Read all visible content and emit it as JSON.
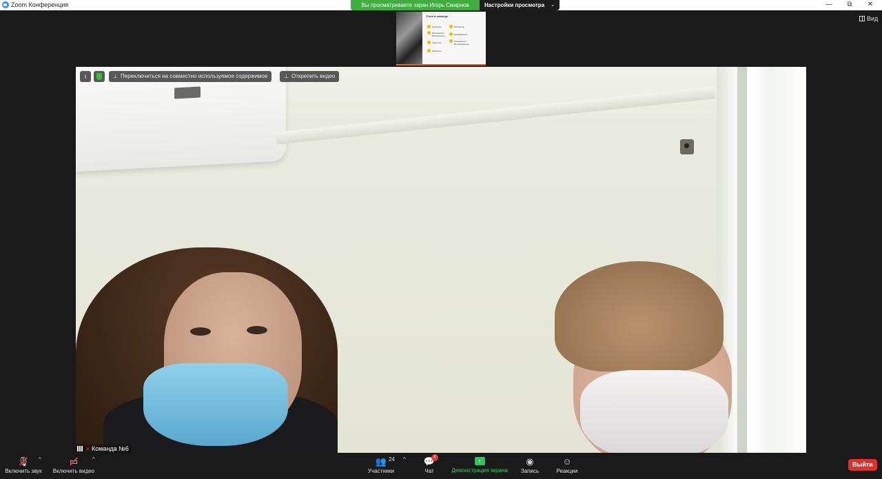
{
  "window": {
    "title": "Zoom Конференция",
    "minimize": "—",
    "restore": "⧉",
    "close": "✕"
  },
  "share_banner": {
    "text": "Вы просматриваете экран Игорь Смирнов",
    "view_options": "Настройки просмотра",
    "chevron": "⌄"
  },
  "thumbnail": {
    "heading": "Роли в команде",
    "items": [
      "Кураторы",
      "Реализатор / Исполнитель",
      "Аналитик",
      "Эксперты",
      "Мотиватор",
      "Наблюдатель",
      "Специалист / Исследователь"
    ]
  },
  "view_button": {
    "label": "Вид"
  },
  "video_controls": {
    "info": "i",
    "switch_label": "Переключиться на совместно используемое содержимое",
    "unpin_label": "Открепить видео"
  },
  "participant": {
    "name": "Команда №6"
  },
  "toolbar": {
    "unmute": "Включить звук",
    "start_video": "Включить видео",
    "participants": "Участники",
    "participants_count": "24",
    "chat": "Чат",
    "chat_badge": "4",
    "share": "Демонстрация экрана",
    "record": "Запись",
    "reactions": "Реакции",
    "leave": "Выйти",
    "caret": "^"
  },
  "colors": {
    "banner_green": "#3fae3f",
    "share_green": "#2ec35b",
    "leave_red": "#d9312f",
    "badge_red": "#e5393b"
  }
}
